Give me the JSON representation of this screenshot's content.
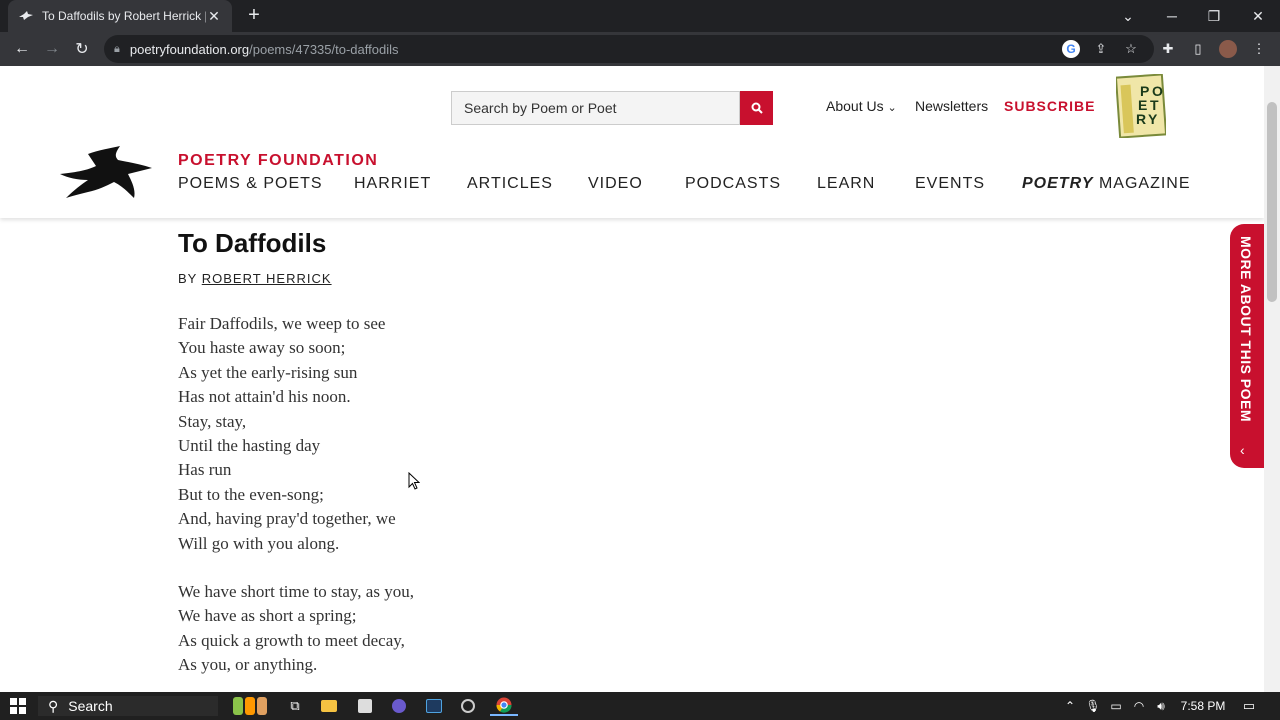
{
  "browser": {
    "tab_title": "To Daffodils by Robert Herrick | P",
    "url_host": "poetryfoundation.org",
    "url_path": "/poems/47335/to-daffodils"
  },
  "header": {
    "search_placeholder": "Search by Poem or Poet",
    "about_label": "About Us",
    "newsletters_label": "Newsletters",
    "subscribe_label": "SUBSCRIBE",
    "org_name": "POETRY FOUNDATION",
    "nav": {
      "poems_poets": "POEMS & POETS",
      "harriet": "HARRIET",
      "articles": "ARTICLES",
      "video": "VIDEO",
      "podcasts": "PODCASTS",
      "learn": "LEARN",
      "events": "EVENTS",
      "magazine_italic": "POETRY",
      "magazine_rest": " MAGAZINE"
    },
    "logo_letters": [
      "P",
      "O",
      "E",
      "T",
      "R",
      "Y"
    ]
  },
  "poem": {
    "title": "To Daffodils",
    "by_label": "BY",
    "author": "ROBERT HERRICK",
    "stanza1": [
      "Fair Daffodils, we weep to see",
      "You haste away so soon;",
      "As yet the early-rising sun",
      "Has not attain'd his noon.",
      "Stay, stay,",
      "Until the hasting day",
      "Has run",
      "But to the even-song;",
      "And, having pray'd together, we",
      "Will go with you along."
    ],
    "stanza2": [
      "We have short time to stay, as you,",
      "We have as short a spring;",
      "As quick a growth to meet decay,",
      "As you, or anything."
    ]
  },
  "side_tab": {
    "label": "MORE ABOUT THIS POEM"
  },
  "taskbar": {
    "search_label": "Search",
    "time": "7:58 PM"
  },
  "colors": {
    "brand_red": "#c8102e",
    "chrome_dark": "#202124",
    "chrome_mid": "#35363a"
  }
}
